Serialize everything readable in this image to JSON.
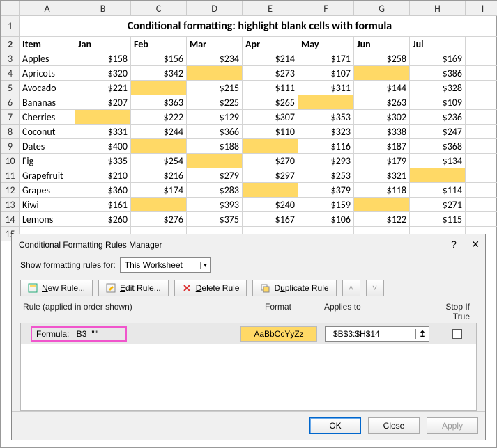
{
  "sheet": {
    "title": "Conditional formatting: highlight blank cells with formula",
    "col_letters": [
      "A",
      "B",
      "C",
      "D",
      "E",
      "F",
      "G",
      "H",
      "I"
    ],
    "headers": [
      "Item",
      "Jan",
      "Feb",
      "Mar",
      "Apr",
      "May",
      "Jun",
      "Jul"
    ],
    "rows": [
      {
        "n": 3,
        "item": "Apples",
        "vals": [
          "$158",
          "$156",
          "$234",
          "$214",
          "$171",
          "$258",
          "$169"
        ],
        "hl": []
      },
      {
        "n": 4,
        "item": "Apricots",
        "vals": [
          "$320",
          "$342",
          "",
          "$273",
          "$107",
          "",
          "$386"
        ],
        "hl": [
          2,
          5
        ]
      },
      {
        "n": 5,
        "item": "Avocado",
        "vals": [
          "$221",
          "",
          "$215",
          "$111",
          "$311",
          "$144",
          "$328"
        ],
        "hl": [
          1
        ]
      },
      {
        "n": 6,
        "item": "Bananas",
        "vals": [
          "$207",
          "$363",
          "$225",
          "$265",
          "",
          "$263",
          "$109"
        ],
        "hl": [
          4
        ]
      },
      {
        "n": 7,
        "item": "Cherries",
        "vals": [
          "",
          "$222",
          "$129",
          "$307",
          "$353",
          "$302",
          "$236"
        ],
        "hl": [
          0
        ]
      },
      {
        "n": 8,
        "item": "Coconut",
        "vals": [
          "$331",
          "$244",
          "$366",
          "$110",
          "$323",
          "$338",
          "$247"
        ],
        "hl": []
      },
      {
        "n": 9,
        "item": "Dates",
        "vals": [
          "$400",
          "",
          "$188",
          "",
          "$116",
          "$187",
          "$368"
        ],
        "hl": [
          1,
          3
        ]
      },
      {
        "n": 10,
        "item": "Fig",
        "vals": [
          "$335",
          "$254",
          "",
          "$270",
          "$293",
          "$179",
          "$134"
        ],
        "hl": [
          2
        ]
      },
      {
        "n": 11,
        "item": "Grapefruit",
        "vals": [
          "$210",
          "$216",
          "$279",
          "$297",
          "$253",
          "$321",
          ""
        ],
        "hl": [
          6
        ]
      },
      {
        "n": 12,
        "item": "Grapes",
        "vals": [
          "$360",
          "$174",
          "$283",
          "",
          "$379",
          "$118",
          "$114"
        ],
        "hl": [
          3
        ]
      },
      {
        "n": 13,
        "item": "Kiwi",
        "vals": [
          "$161",
          "",
          "$393",
          "$240",
          "$159",
          "",
          "$271"
        ],
        "hl": [
          1,
          5
        ]
      },
      {
        "n": 14,
        "item": "Lemons",
        "vals": [
          "$260",
          "$276",
          "$375",
          "$167",
          "$106",
          "$122",
          "$115"
        ],
        "hl": []
      }
    ],
    "extra_row": 15
  },
  "dialog": {
    "title": "Conditional Formatting Rules Manager",
    "show_label_pre": "S",
    "show_label_post": "how formatting rules for:",
    "show_value": "This Worksheet",
    "buttons": {
      "new": "New Rule...",
      "edit": "Edit Rule...",
      "delete": "Delete Rule",
      "duplicate": "Duplicate Rule"
    },
    "columns": {
      "rule": "Rule (applied in order shown)",
      "format": "Format",
      "applies": "Applies to",
      "stop": "Stop If True"
    },
    "rule": {
      "formula": "Formula: =B3=\"\"",
      "sample": "AaBbCcYyZz",
      "applies_to": "=$B$3:$H$14"
    },
    "footer": {
      "ok": "OK",
      "close": "Close",
      "apply": "Apply"
    }
  }
}
